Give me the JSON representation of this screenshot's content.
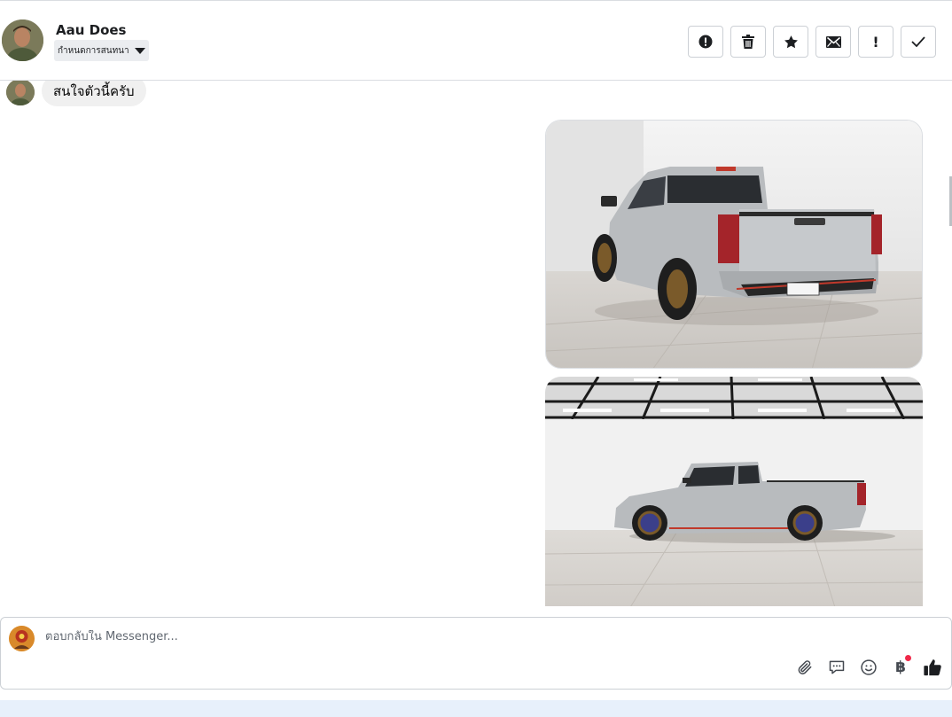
{
  "header": {
    "contact_name": "Aau Does",
    "assign_label": "กำหนดการสนทนา",
    "actions": [
      {
        "name": "report-spam-button",
        "icon": "exclamation-circle-icon"
      },
      {
        "name": "delete-button",
        "icon": "trash-icon"
      },
      {
        "name": "star-button",
        "icon": "star-icon"
      },
      {
        "name": "mark-unread-button",
        "icon": "envelope-icon"
      },
      {
        "name": "follow-up-button",
        "icon": "exclamation-icon",
        "label": "!"
      },
      {
        "name": "mark-done-button",
        "icon": "checkmark-icon"
      }
    ]
  },
  "chat": {
    "incoming_message": "สนใจตัวนี้ครับ"
  },
  "composer": {
    "placeholder": "ตอบกลับใน Messenger...",
    "tools": [
      "paperclip-icon",
      "saved-reply-icon",
      "emoji-icon",
      "baht-payment-icon",
      "thumbs-up-icon"
    ],
    "baht_symbol": "฿"
  },
  "colors": {
    "border": "#dadde1",
    "bubble": "#f0f0f0",
    "icon": "#444950",
    "notification": "#f02849",
    "footer": "#e7f0fb"
  }
}
